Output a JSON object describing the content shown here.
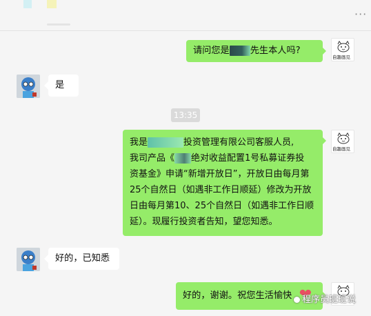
{
  "header": {
    "more_icon": "more-icon"
  },
  "time_divider": "13:35",
  "messages": [
    {
      "side": "right",
      "text_before": "请问您是",
      "text_after": "先生本人吗?"
    },
    {
      "side": "left",
      "text": "是"
    },
    {
      "side": "right",
      "line1_before": "我是",
      "line1_after": "投资管理有限公司客服人员,",
      "line2_before": "我司产品《",
      "line2_after": "绝对收益配置1号私募证券投",
      "rest": "资基金》申请“新增开放日”，开放日由每月第25个自然日（如遇非工作日顺延）修改为开放日由每月第10、25个自然日（如遇非工作日顺延）。现履行投资者告知，望您知悉。"
    },
    {
      "side": "left",
      "text": "好的，已知悉"
    },
    {
      "side": "right",
      "text": "好的，谢谢。祝您生活愉快"
    }
  ],
  "agent_avatar_caption": "自趣画见",
  "watermark": "程序员班班说",
  "colors": {
    "sent_bubble": "#95ec69",
    "received_bubble": "#ffffff",
    "background": "#f5f5f5"
  }
}
